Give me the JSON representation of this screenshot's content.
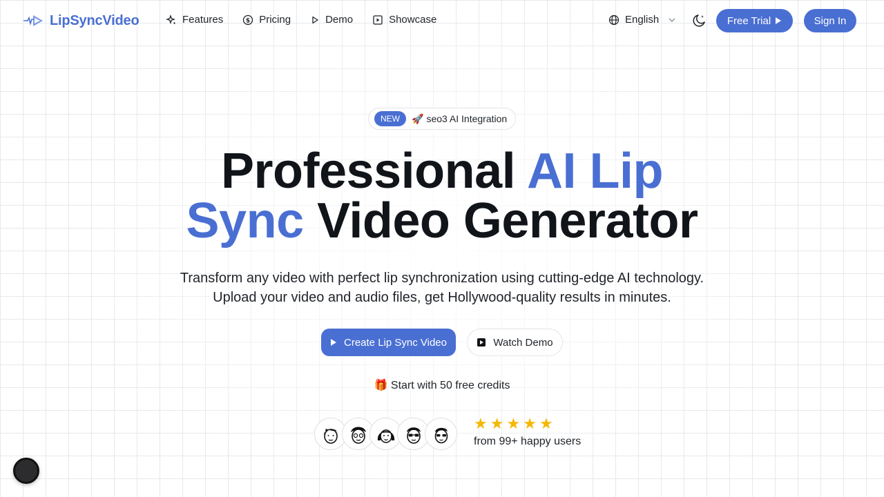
{
  "brand": {
    "name": "LipSyncVideo",
    "accent_color": "#4a6fd3"
  },
  "nav": {
    "items": [
      {
        "label": "Features",
        "icon": "sparkles-icon"
      },
      {
        "label": "Pricing",
        "icon": "dollar-circle-icon"
      },
      {
        "label": "Demo",
        "icon": "play-icon"
      },
      {
        "label": "Showcase",
        "icon": "play-square-icon"
      }
    ],
    "language": "English",
    "free_trial": "Free Trial",
    "sign_in": "Sign In"
  },
  "hero": {
    "badge_new": "NEW",
    "badge_emoji": "🚀",
    "badge_text": "seo3 AI Integration",
    "title_part1": "Professional ",
    "title_accent1": "AI Lip",
    "title_accent2": "Sync",
    "title_part2": " Video Generator",
    "subtitle_line1": "Transform any video with perfect lip synchronization using cutting-edge AI technology.",
    "subtitle_line2": "Upload your video and audio files, get Hollywood-quality results in minutes.",
    "primary_cta": "Create Lip Sync Video",
    "secondary_cta": "Watch Demo",
    "credits_emoji": "🎁",
    "credits_text": "Start with 50 free credits",
    "rating_stars": 5,
    "social_proof": "from 99+ happy users"
  }
}
